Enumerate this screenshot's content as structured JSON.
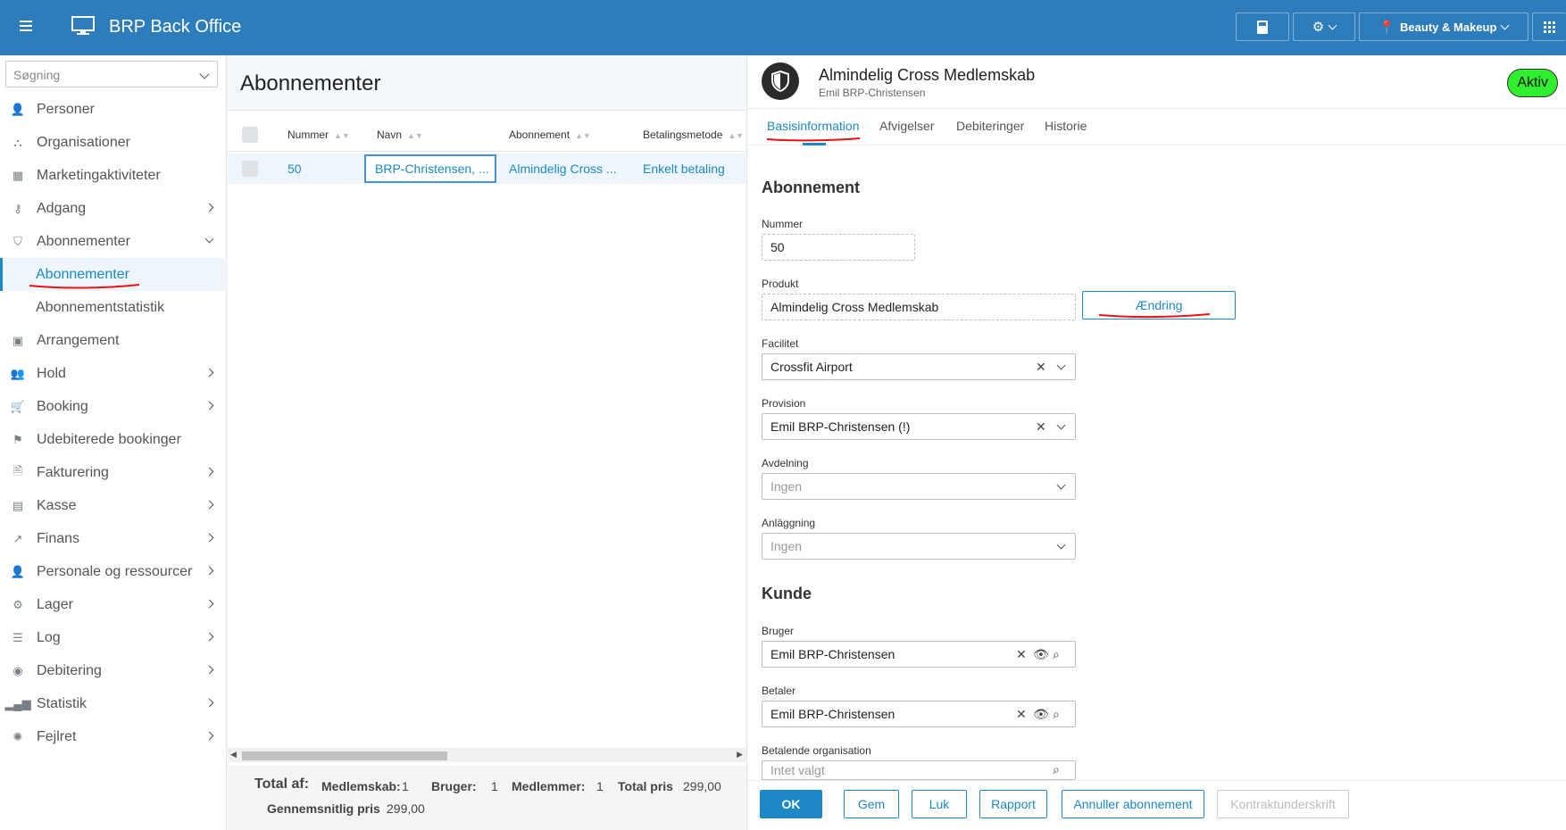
{
  "app": {
    "title": "BRP Back Office"
  },
  "topbar": {
    "location_label": "Beauty & Makeup"
  },
  "sidebar": {
    "search_placeholder": "Søgning",
    "items": [
      {
        "label": "Personer"
      },
      {
        "label": "Organisationer"
      },
      {
        "label": "Marketingaktiviteter"
      },
      {
        "label": "Adgang"
      },
      {
        "label": "Abonnementer"
      },
      {
        "label": "Abonnementer"
      },
      {
        "label": "Abonnementstatistik"
      },
      {
        "label": "Arrangement"
      },
      {
        "label": "Hold"
      },
      {
        "label": "Booking"
      },
      {
        "label": "Udebiterede bookinger"
      },
      {
        "label": "Fakturering"
      },
      {
        "label": "Kasse"
      },
      {
        "label": "Finans"
      },
      {
        "label": "Personale og ressourcer"
      },
      {
        "label": "Lager"
      },
      {
        "label": "Log"
      },
      {
        "label": "Debitering"
      },
      {
        "label": "Statistik"
      },
      {
        "label": "Fejlret"
      }
    ]
  },
  "list": {
    "title": "Abonnementer",
    "columns": [
      "Nummer",
      "Navn",
      "Abonnement",
      "Betalingsmetode"
    ],
    "rows": [
      {
        "nummer": "50",
        "navn": "BRP-Christensen, ...",
        "abonnement": "Almindelig Cross ...",
        "betaling": "Enkelt betaling"
      }
    ],
    "footer": {
      "total_label": "Total af:",
      "medlemskab_label": "Medlemskab:",
      "medlemskab": "1",
      "bruger_label": "Bruger:",
      "bruger": "1",
      "medlemmer_label": "Medlemmer:",
      "medlemmer": "1",
      "totalpris_label": "Total pris",
      "totalpris": "299,00",
      "snit_label": "Gennemsnitlig pris",
      "snit": "299,00"
    }
  },
  "detail": {
    "title": "Almindelig Cross Medlemskab",
    "subtitle": "Emil BRP-Christensen",
    "status": "Aktiv",
    "tabs": [
      "Basisinformation",
      "Afvigelser",
      "Debiteringer",
      "Historie"
    ],
    "section_abonnement": "Abonnement",
    "nummer_label": "Nummer",
    "nummer": "50",
    "produkt_label": "Produkt",
    "produkt": "Almindelig Cross Medlemskab",
    "change_button": "Ændring",
    "facilitet_label": "Facilitet",
    "facilitet": "Crossfit Airport",
    "provision_label": "Provision",
    "provision": "Emil BRP-Christensen (!)",
    "avdelning_label": "Avdelning",
    "avdelning_placeholder": "Ingen",
    "anlaggning_label": "Anläggning",
    "anlaggning_placeholder": "Ingen",
    "section_kunde": "Kunde",
    "bruger_label": "Bruger",
    "bruger": "Emil BRP-Christensen",
    "betaler_label": "Betaler",
    "betaler": "Emil BRP-Christensen",
    "betorg_label": "Betalende organisation",
    "betorg_placeholder": "Intet valgt",
    "actions": [
      "OK",
      "Gem",
      "Luk",
      "Rapport",
      "Annuller abonnement",
      "Kontraktunderskrift"
    ]
  }
}
